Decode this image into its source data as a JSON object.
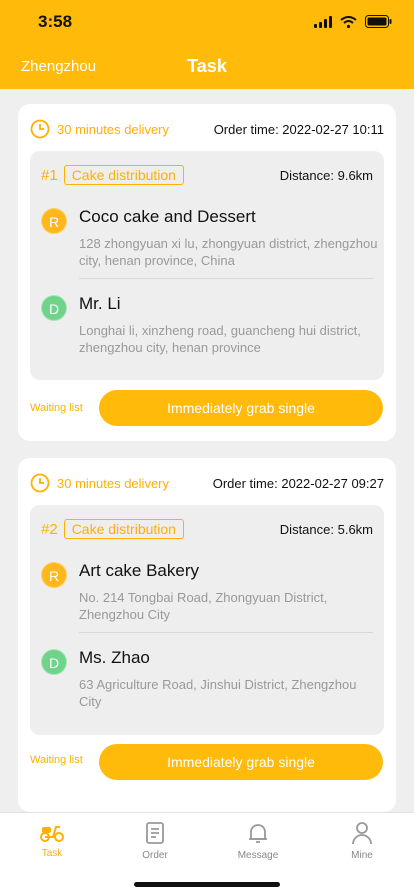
{
  "status": {
    "time": "3:58"
  },
  "header": {
    "city": "Zhengzhou",
    "title": "Task"
  },
  "orders": [
    {
      "delivery": "30 minutes delivery",
      "order_time": "Order time: 2022-02-27 10:11",
      "number": "#1",
      "tag": "Cake distribution",
      "distance": "Distance: 9.6km",
      "pickup": {
        "badge": "R",
        "name": "Coco cake and Dessert",
        "address": "128 zhongyuan xi lu, zhongyuan district, zhengzhou city, henan province, China"
      },
      "dropoff": {
        "badge": "D",
        "name": "Mr. Li",
        "address": "Longhai li, xinzheng road, guancheng hui district, zhengzhou city, henan province"
      },
      "waiting": "Waiting list",
      "button": "Immediately grab single"
    },
    {
      "delivery": "30 minutes delivery",
      "order_time": "Order time: 2022-02-27 09:27",
      "number": "#2",
      "tag": "Cake distribution",
      "distance": "Distance: 5.6km",
      "pickup": {
        "badge": "R",
        "name": "Art cake Bakery",
        "address": "No. 214 Tongbai Road, Zhongyuan District, Zhengzhou City"
      },
      "dropoff": {
        "badge": "D",
        "name": "Ms. Zhao",
        "address": "63 Agriculture Road, Jinshui District, Zhengzhou City"
      },
      "waiting": "Waiting list",
      "button": "Immediately grab single"
    }
  ],
  "tabs": [
    {
      "label": "Task",
      "icon": "scooter-icon",
      "active": true
    },
    {
      "label": "Order",
      "icon": "order-document-icon",
      "active": false
    },
    {
      "label": "Message",
      "icon": "bell-icon",
      "active": false
    },
    {
      "label": "Mine",
      "icon": "person-icon",
      "active": false
    }
  ],
  "colors": {
    "accent": "#ffba0a",
    "pickup_badge": "#ffb81c",
    "dropoff_badge": "#6fd38a"
  }
}
